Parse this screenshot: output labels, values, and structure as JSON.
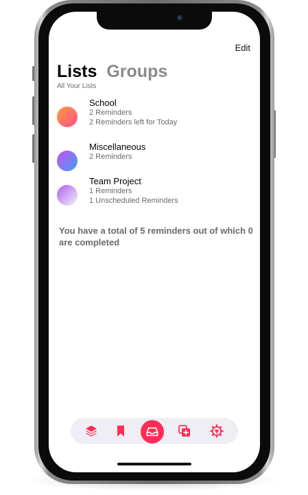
{
  "header": {
    "edit_label": "Edit"
  },
  "tabs": [
    {
      "label": "Lists",
      "active": true
    },
    {
      "label": "Groups",
      "active": false
    }
  ],
  "subtitle": "All Your Lists",
  "lists": [
    {
      "title": "School",
      "lines": [
        "2 Reminders",
        "2 Reminders left for Today"
      ],
      "gradient": [
        "#ff9a3c",
        "#ff4f8b"
      ]
    },
    {
      "title": "Miscellaneous",
      "lines": [
        "2 Reminders"
      ],
      "gradient": [
        "#c850f0",
        "#3fa0f5"
      ]
    },
    {
      "title": "Team Project",
      "lines": [
        "1 Reminders",
        "1 Unscheduled Reminders"
      ],
      "gradient": [
        "#b25cf0",
        "#f2f2f7"
      ]
    }
  ],
  "summary": "You have a total of 5 reminders out of which 0 are completed",
  "tabbar": {
    "icons": [
      "layers-icon",
      "bookmark-icon",
      "inbox-tray-icon",
      "add-copy-icon",
      "gear-icon"
    ],
    "active_index": 2
  },
  "colors": {
    "accent": "#ff2d55",
    "tabbar_bg": "#eeeef4",
    "secondary_text": "#6a6a6a"
  }
}
